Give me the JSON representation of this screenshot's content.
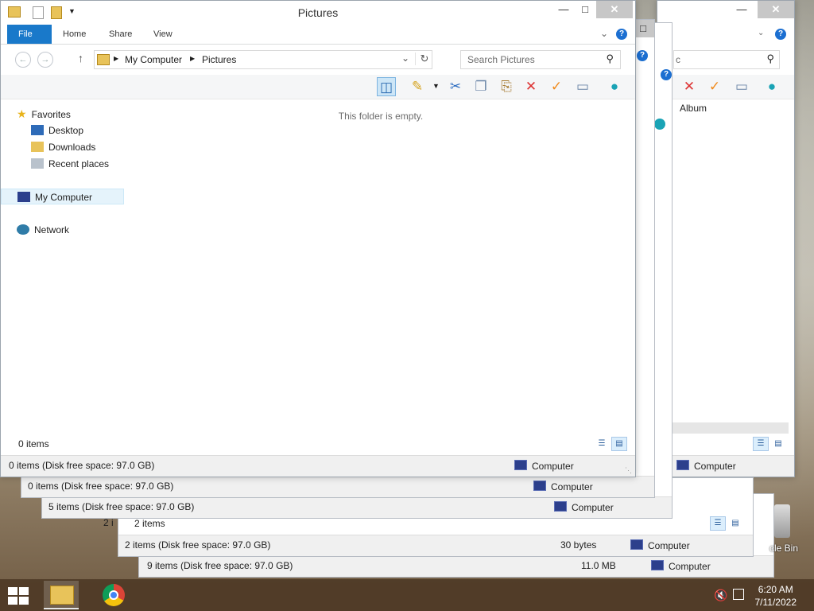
{
  "main_window": {
    "title": "Pictures",
    "tabs": [
      "File",
      "Home",
      "Share",
      "View"
    ],
    "breadcrumb": [
      "My Computer",
      "Pictures"
    ],
    "search_placeholder": "Search Pictures",
    "empty_message": "This folder is empty.",
    "item_count": "0 items",
    "status_text": "0 items (Disk free space: 97.0 GB)",
    "status_location": "Computer"
  },
  "nav": {
    "favorites": "Favorites",
    "desktop": "Desktop",
    "downloads": "Downloads",
    "recent": "Recent places",
    "my_computer": "My Computer",
    "network": "Network"
  },
  "back_windows": [
    {
      "status_text": "0 items (Disk free space: 97.0 GB)",
      "location": "Computer"
    },
    {
      "status_text": "5 items (Disk free space: 97.0 GB)",
      "location": "Computer"
    },
    {
      "item_count": "2 items",
      "status_text": "2 items (Disk free space: 97.0 GB)",
      "size": "30 bytes",
      "location": "Computer",
      "count_fragment": "2 i"
    },
    {
      "status_text": "9 items (Disk free space: 97.0 GB)",
      "size": "11.0 MB",
      "location": "Computer"
    },
    {
      "search_fragment": "c",
      "album_label": "Album",
      "location": "Computer"
    }
  ],
  "desktop": {
    "recycle_bin_fragment": "cle Bin"
  },
  "taskbar": {
    "time": "6:20 AM",
    "date": "7/11/2022"
  },
  "colors": {
    "accent": "#1979ca",
    "close_button": "#c7c7c7",
    "status_bar": "#f0f0f0"
  }
}
